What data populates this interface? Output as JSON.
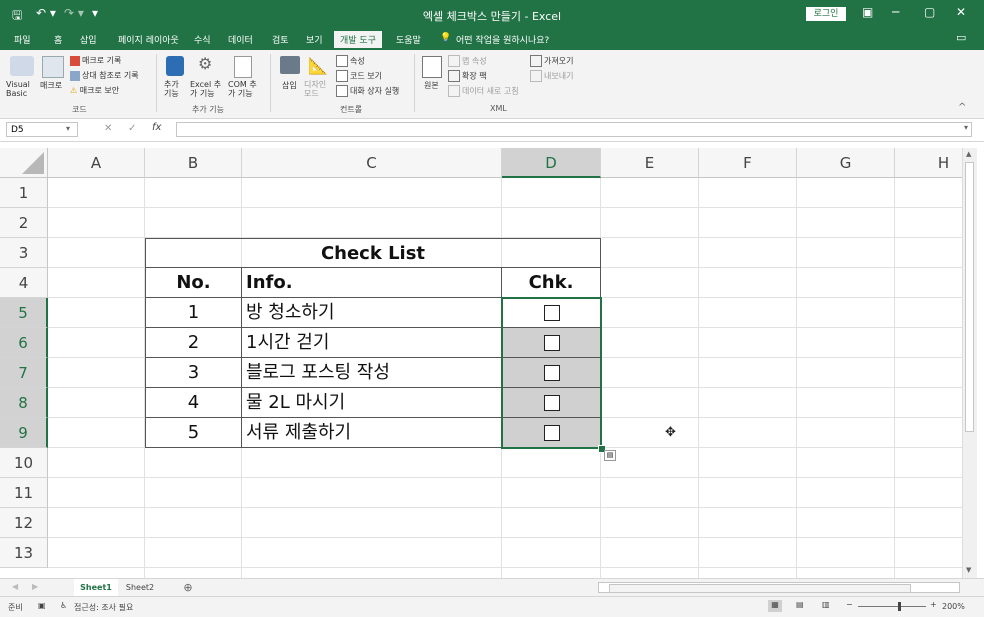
{
  "titlebar": {
    "title": "엑셀 체크박스 만들기 - Excel",
    "login": "로그인",
    "qa_save": "🖫",
    "qa_undo": "↶ ▾",
    "qa_redo": "↷ ▾",
    "qa_more": "▾",
    "btn_display": "▣",
    "btn_min": "─",
    "btn_max": "▢",
    "btn_close": "✕"
  },
  "menu": {
    "tabs": [
      "파일",
      "홈",
      "삽입",
      "페이지 레이아웃",
      "수식",
      "데이터",
      "검토",
      "보기",
      "개발 도구",
      "도움말"
    ],
    "active": "개발 도구",
    "search": "어떤 작업을 원하시나요?",
    "comment_icon": "▭"
  },
  "ribbon": {
    "code": {
      "visual_basic": "Visual Basic",
      "macro": "매크로",
      "record": "매크로 기록",
      "relative": "상대 참조로 기록",
      "security": "매크로 보안",
      "label": "코드"
    },
    "addins": {
      "add": "추가 기능",
      "excel_add": "Excel 추가 기능",
      "com_add": "COM 추가 기능",
      "label": "추가 기능"
    },
    "controls": {
      "insert": "삽입",
      "design": "디자인 모드",
      "properties": "속성",
      "view_code": "코드 보기",
      "dialog": "대화 상자 실행",
      "label": "컨트롤"
    },
    "xml": {
      "source": "원본",
      "map_props": "맵 속성",
      "expansion": "확장 팩",
      "refresh": "데이터 새로 고침",
      "import": "가져오기",
      "export": "내보내기",
      "label": "XML"
    },
    "collapse": "^"
  },
  "formula_bar": {
    "cell_ref": "D5",
    "fx": "fx",
    "cancel": "✕",
    "enter": "✓",
    "value": ""
  },
  "grid": {
    "columns": [
      "A",
      "B",
      "C",
      "D",
      "E",
      "F",
      "G",
      "H"
    ],
    "rows": [
      "1",
      "2",
      "3",
      "4",
      "5",
      "6",
      "7",
      "8",
      "9",
      "10",
      "11",
      "12",
      "13"
    ],
    "selected_col": "D"
  },
  "table": {
    "title": "Check List",
    "header_no": "No.",
    "header_info": "Info.",
    "header_chk": "Chk.",
    "items": [
      {
        "no": "1",
        "info": "방 청소하기"
      },
      {
        "no": "2",
        "info": "1시간 걷기"
      },
      {
        "no": "3",
        "info": "블로그 포스팅 작성"
      },
      {
        "no": "4",
        "info": "물 2L 마시기"
      },
      {
        "no": "5",
        "info": "서류 제출하기"
      }
    ]
  },
  "sheets": {
    "tabs": [
      "Sheet1",
      "Sheet2"
    ],
    "active": "Sheet1",
    "add": "⊕"
  },
  "status": {
    "ready": "준비",
    "accessibility": "접근성: 조사 필요",
    "zoom": "200%",
    "zoom_minus": "−",
    "zoom_plus": "+"
  },
  "colors": {
    "excel_green": "#217346",
    "selection_fill": "#d0d0d0"
  }
}
